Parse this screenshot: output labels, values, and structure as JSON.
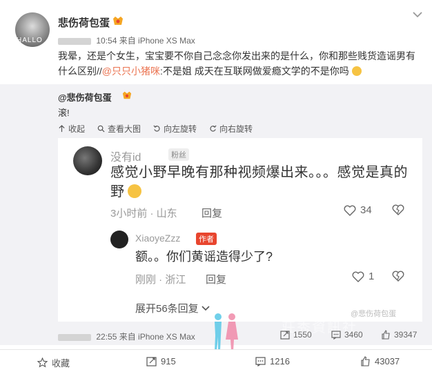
{
  "post": {
    "username": "悲伤荷包蛋",
    "avatar_text": "HALLO",
    "time": "10:54",
    "source": "来自 iPhone XS Max",
    "text_before": "我晕，还是个女生，宝宝要不你自己念念你发出来的是什么，你和那些贱货造谣男有什么区别//",
    "mention": "@只只小猪咪",
    "text_after": ":不是姐 成天在互联网做爱瘾文学的不是你吗"
  },
  "repost": {
    "username": "@悲伤荷包蛋",
    "text": "滚!",
    "tools": [
      "收起",
      "查看大图",
      "向左旋转",
      "向右旋转"
    ]
  },
  "screenshot": {
    "comment1": {
      "name": "没有id",
      "tag": "粉丝",
      "text": "感觉小野早晚有那种视频爆出来。。。感觉是真的野",
      "meta": "3小时前 · 山东",
      "reply": "回复",
      "likes": "34"
    },
    "comment2": {
      "name": "XiaoyeZzz",
      "tag": "作者",
      "text": "额。。你们黄谣造得少了?",
      "meta": "刚刚 · 浙江",
      "reply": "回复",
      "likes": "1"
    },
    "expand": "展开56条回复",
    "watermark": "@悲伤荷包蛋"
  },
  "repost_footer": {
    "time": "22:55",
    "source": "来自 iPhone XS Max",
    "reposts": "1550",
    "comments": "3460",
    "likes": "39347",
    "watermark": "莊秀資訊社"
  },
  "actions": {
    "favorite": "收藏",
    "repost": "915",
    "comment": "1216",
    "like": "43037"
  },
  "colors": {
    "mention": "#eb7350",
    "author_tag": "#e8452e",
    "repost_bg": "#f2f2f5"
  }
}
